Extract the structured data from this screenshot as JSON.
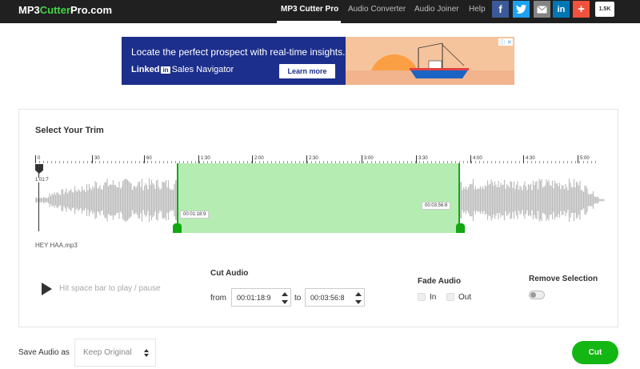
{
  "nav": {
    "logo_prefix": "MP3",
    "logo_accent": "Cutter",
    "logo_suffix": "Pro.com",
    "links": [
      "MP3 Cutter Pro",
      "Audio Converter",
      "Audio Joiner",
      "Help"
    ],
    "share_count": "1.5K"
  },
  "social": [
    {
      "icon": "facebook-icon",
      "glyph": "f",
      "color": "#3b5998"
    },
    {
      "icon": "twitter-icon",
      "glyph": "t",
      "color": "#1da1f2"
    },
    {
      "icon": "email-icon",
      "glyph": "✉",
      "color": "#848484"
    },
    {
      "icon": "linkedin-icon",
      "glyph": "in",
      "color": "#0077b5"
    },
    {
      "icon": "plus-icon",
      "glyph": "+",
      "color": "#f0523d"
    }
  ],
  "ad": {
    "headline": "Locate the perfect prospect with real-time insights.",
    "brand_1": "Linked",
    "brand_in": "in",
    "brand_2": "Sales Navigator",
    "button": "Learn more"
  },
  "trim": {
    "title": "Select Your Trim",
    "ticks": [
      "0",
      "30",
      "60",
      "1:30",
      "2:00",
      "2:30",
      "3:00",
      "3:30",
      "4:00",
      "4:30",
      "5:00"
    ],
    "playhead_time": "1:01:7",
    "selection_start": "00:01:18:9",
    "selection_end": "00:03:56:8",
    "filename": "HEY HAA.mp3"
  },
  "controls": {
    "play_hint": "Hit space bar to play / pause",
    "cut_audio_label": "Cut Audio",
    "from_label": "from",
    "to_label": "to",
    "from_value": "00:01:18:9",
    "to_value": "00:03:56:8",
    "fade_label": "Fade Audio",
    "fade_in": "In",
    "fade_out": "Out",
    "remove_label": "Remove Selection"
  },
  "footer": {
    "save_label": "Save Audio as",
    "save_option": "Keep Original",
    "cut_button": "Cut"
  },
  "colors": {
    "accent_green": "#14b614",
    "selection_fill": "#b4ecb1",
    "nav_bg": "#202020"
  }
}
